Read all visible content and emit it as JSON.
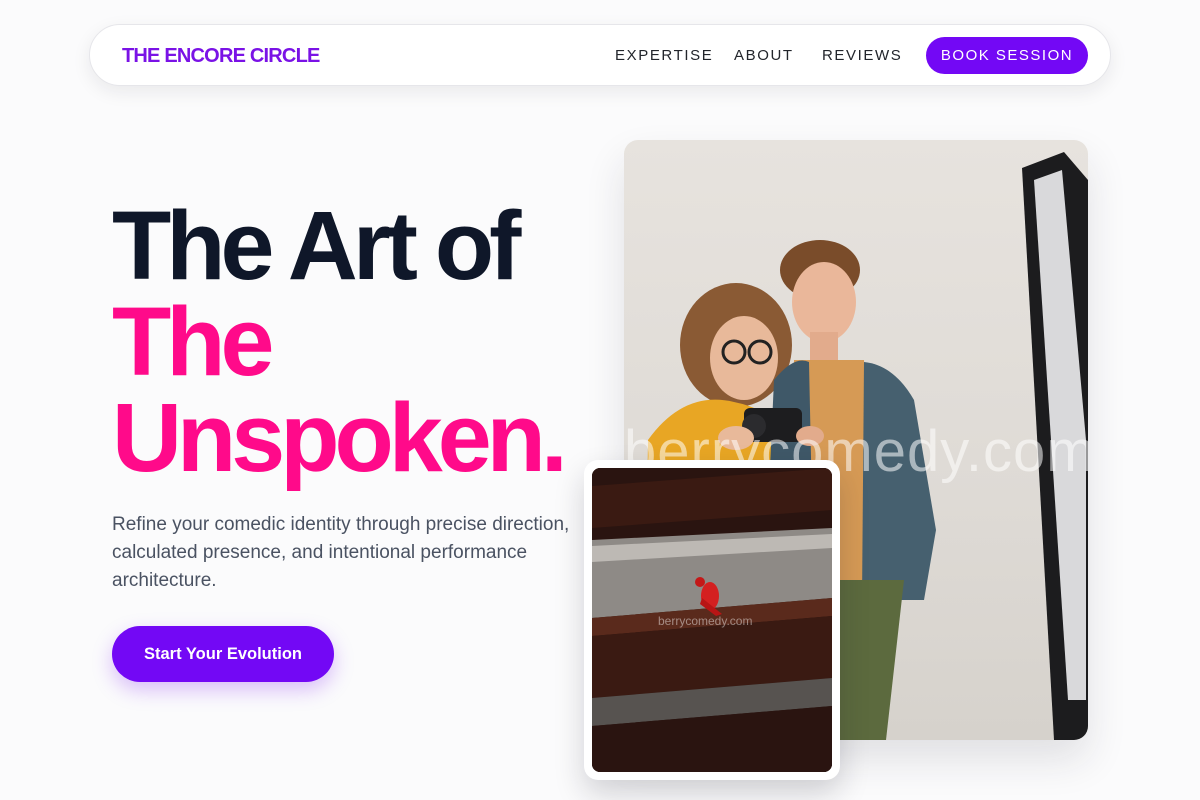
{
  "nav": {
    "logo": "THE ENCORE CIRCLE",
    "links": [
      "EXPERTISE",
      "ABOUT",
      "REVIEWS"
    ],
    "book_label": "BOOK SESSION"
  },
  "hero": {
    "headline_line1": "The Art of",
    "headline_line2": "The",
    "headline_line3": "Unspoken.",
    "subtext": "Refine your comedic identity through precise direction, calculated presence, and intentional performance architecture.",
    "cta_label": "Start Your Evolution"
  },
  "images": {
    "main_watermark": "berrycomedy.com",
    "inset_watermark": "berrycomedy.com"
  },
  "colors": {
    "accent": "#7308f5",
    "pink": "#ff0a8a",
    "dark": "#0f1729",
    "logo": "#7a12e6"
  }
}
